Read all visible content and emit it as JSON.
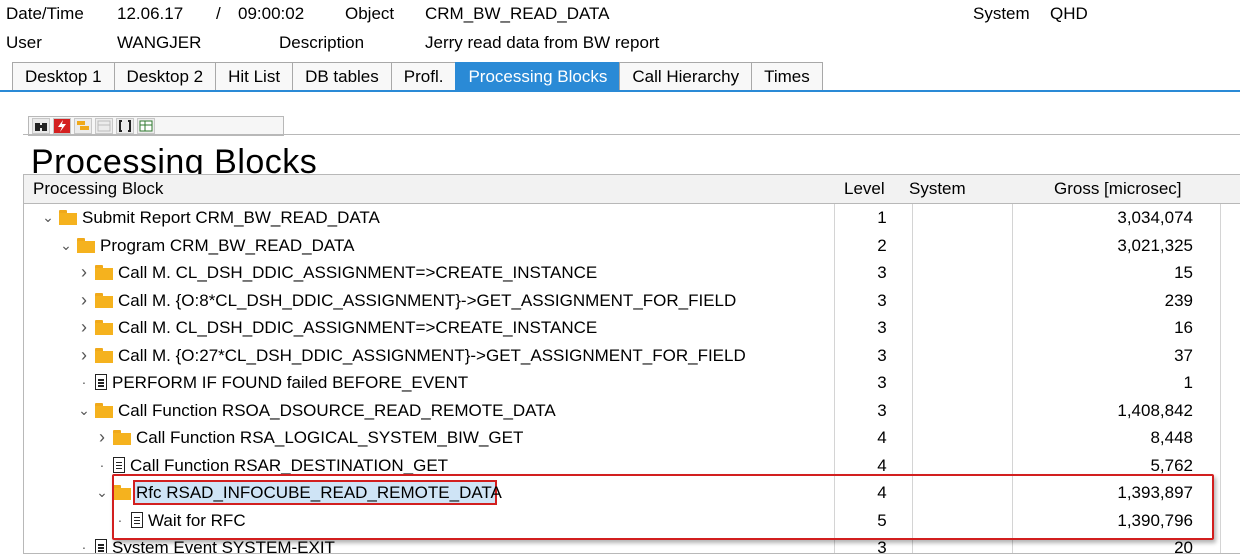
{
  "header": {
    "datetime_label": "Date/Time",
    "date": "12.06.17",
    "sep": "/",
    "time": "09:00:02",
    "object_label": "Object",
    "object_value": "CRM_BW_READ_DATA",
    "system_label": "System",
    "system_value": "QHD",
    "user_label": "User",
    "user_value": "WANGJER",
    "description_label": "Description",
    "description_value": "Jerry read data from BW report"
  },
  "tabs": [
    {
      "label": "Desktop 1"
    },
    {
      "label": "Desktop 2"
    },
    {
      "label": "Hit List"
    },
    {
      "label": "DB tables"
    },
    {
      "label": "Profl."
    },
    {
      "label": "Processing Blocks",
      "active": true
    },
    {
      "label": "Call Hierarchy"
    },
    {
      "label": "Times"
    }
  ],
  "toolbar_icons": [
    "binoculars-icon",
    "lightning-icon",
    "expand-icon",
    "layout-icon",
    "bracket-icon",
    "table-icon"
  ],
  "page_title": "Processing Blocks",
  "grid": {
    "columns": {
      "block": "Processing Block",
      "level": "Level",
      "system": "System",
      "gross": "Gross [microsec]"
    },
    "rows": [
      {
        "indent": 0,
        "expander": "down",
        "icon": "folder",
        "label": "Submit Report CRM_BW_READ_DATA",
        "level": "1",
        "gross": "3,034,074"
      },
      {
        "indent": 1,
        "expander": "down",
        "icon": "folder",
        "label": "Program CRM_BW_READ_DATA",
        "level": "2",
        "gross": "3,021,325"
      },
      {
        "indent": 2,
        "expander": "right",
        "icon": "folder",
        "label": "Call M. CL_DSH_DDIC_ASSIGNMENT=>CREATE_INSTANCE",
        "level": "3",
        "gross": "15"
      },
      {
        "indent": 2,
        "expander": "right",
        "icon": "folder",
        "label": "Call M. {O:8*CL_DSH_DDIC_ASSIGNMENT}->GET_ASSIGNMENT_FOR_FIELD",
        "level": "3",
        "gross": "239"
      },
      {
        "indent": 2,
        "expander": "right",
        "icon": "folder",
        "label": "Call M. CL_DSH_DDIC_ASSIGNMENT=>CREATE_INSTANCE",
        "level": "3",
        "gross": "16"
      },
      {
        "indent": 2,
        "expander": "right",
        "icon": "folder",
        "label": "Call M. {O:27*CL_DSH_DDIC_ASSIGNMENT}->GET_ASSIGNMENT_FOR_FIELD",
        "level": "3",
        "gross": "37"
      },
      {
        "indent": 2,
        "expander": "dot",
        "icon": "doc",
        "label": "PERFORM IF FOUND failed BEFORE_EVENT",
        "level": "3",
        "gross": "1"
      },
      {
        "indent": 2,
        "expander": "down",
        "icon": "folder",
        "label": "Call Function RSOA_DSOURCE_READ_REMOTE_DATA",
        "level": "3",
        "gross": "1,408,842"
      },
      {
        "indent": 3,
        "expander": "right",
        "icon": "folder",
        "label": "Call Function RSA_LOGICAL_SYSTEM_BIW_GET",
        "level": "4",
        "gross": "8,448"
      },
      {
        "indent": 3,
        "expander": "dot",
        "icon": "doc",
        "label": "Call Function RSAR_DESTINATION_GET",
        "level": "4",
        "gross": "5,762"
      },
      {
        "indent": 3,
        "expander": "down",
        "icon": "folder",
        "label": "Rfc RSAD_INFOCUBE_READ_REMOTE_DATA",
        "level": "4",
        "gross": "1,393,897",
        "selected": true
      },
      {
        "indent": 4,
        "expander": "dot",
        "icon": "doc",
        "label": "Wait for RFC",
        "level": "5",
        "gross": "1,390,796"
      },
      {
        "indent": 2,
        "expander": "dot",
        "icon": "doc",
        "label": "System Event SYSTEM-EXIT",
        "level": "3",
        "gross": "20"
      }
    ]
  }
}
